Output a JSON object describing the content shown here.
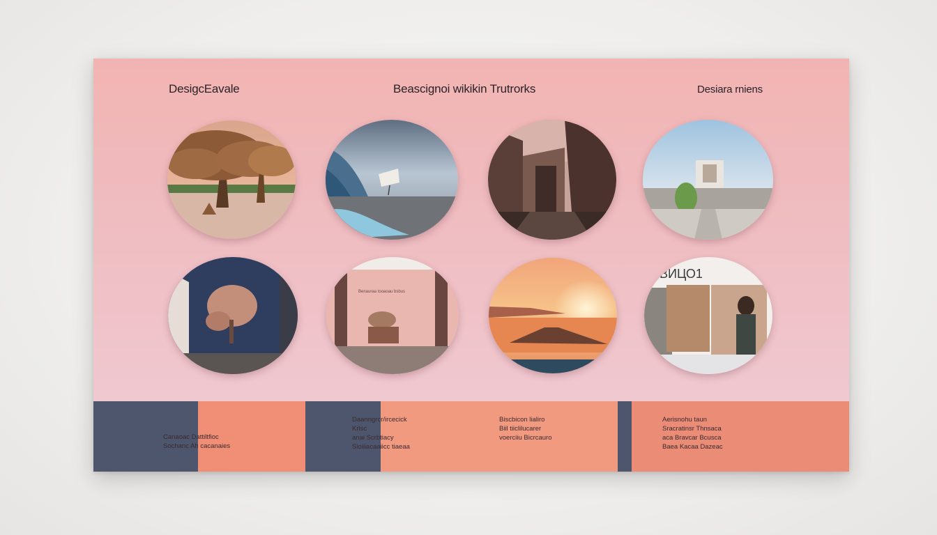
{
  "header": {
    "left": "DesigcEavale",
    "center": "Beascignoi wikikin Trutrorks",
    "right": "Desiara rniens"
  },
  "tiles": [
    {
      "icon": "tree-landscape-image"
    },
    {
      "icon": "ocean-wave-image"
    },
    {
      "icon": "alley-buildings-image"
    },
    {
      "icon": "modern-house-image"
    },
    {
      "icon": "tree-mural-image"
    },
    {
      "icon": "pink-room-image"
    },
    {
      "icon": "sunset-sea-image"
    },
    {
      "icon": "shop-front-image"
    }
  ],
  "tile_texts": {
    "room_wall": "Benauraa tooaoau bsbus"
  },
  "shop_sign": "ВИЦО1",
  "footer": {
    "col1": [
      "Canaoac Dattiltfioc",
      "Sochanc Ah  cacanaies"
    ],
    "col2": [
      "Daanngrcr/ircecick",
      "Krlsc",
      "anai Scrbtiacy",
      "Sioiiiacaaiicc tiaeaa"
    ],
    "col3": [
      "Biscbicon lialiro",
      "Biil tiiclilucarer",
      "voerciiu Bicrcauro"
    ],
    "col4": [
      "Aerisnohu taun",
      "Sracratinsr Thnsaca",
      "aca Bravcar Bcusca",
      "Baea Kacaa Dazeac"
    ]
  },
  "colors": {
    "panel_top": "#f2b4b2",
    "panel_bottom": "#f0c8d0",
    "footer_navy": "#4d566c",
    "footer_coral": "#f08e76",
    "footer_salmon": "#ea8c76"
  }
}
